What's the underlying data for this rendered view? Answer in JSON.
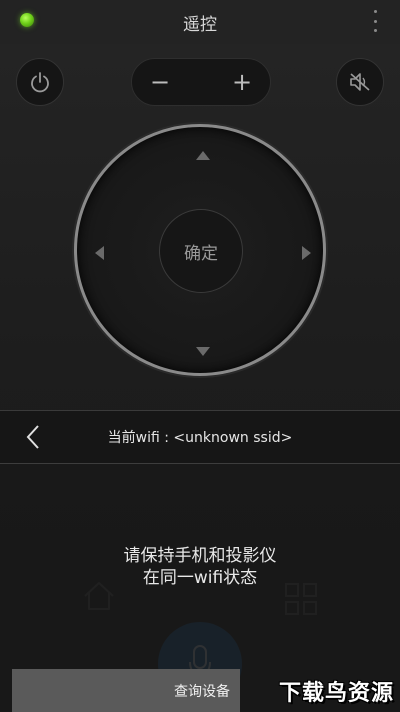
{
  "header": {
    "title": "遥控",
    "status_color": "#6fd01a"
  },
  "controls": {
    "power_icon": "power-icon",
    "mute_icon": "volume-mute-icon",
    "volume_minus": "−",
    "volume_plus": "+",
    "ok_label": "确定"
  },
  "bottom_icons": {
    "home_icon": "home-icon",
    "grid_icon": "grid-icon",
    "mic_icon": "microphone-icon",
    "mic_color": "#1a5fa0"
  },
  "dialog": {
    "wifi_text": "当前wifi : <unknown ssid>",
    "hint_line1": "请保持手机和投影仪",
    "hint_line2": "在同一wifi状态",
    "query_button": "查询设备"
  },
  "watermark": "下载鸟资源"
}
